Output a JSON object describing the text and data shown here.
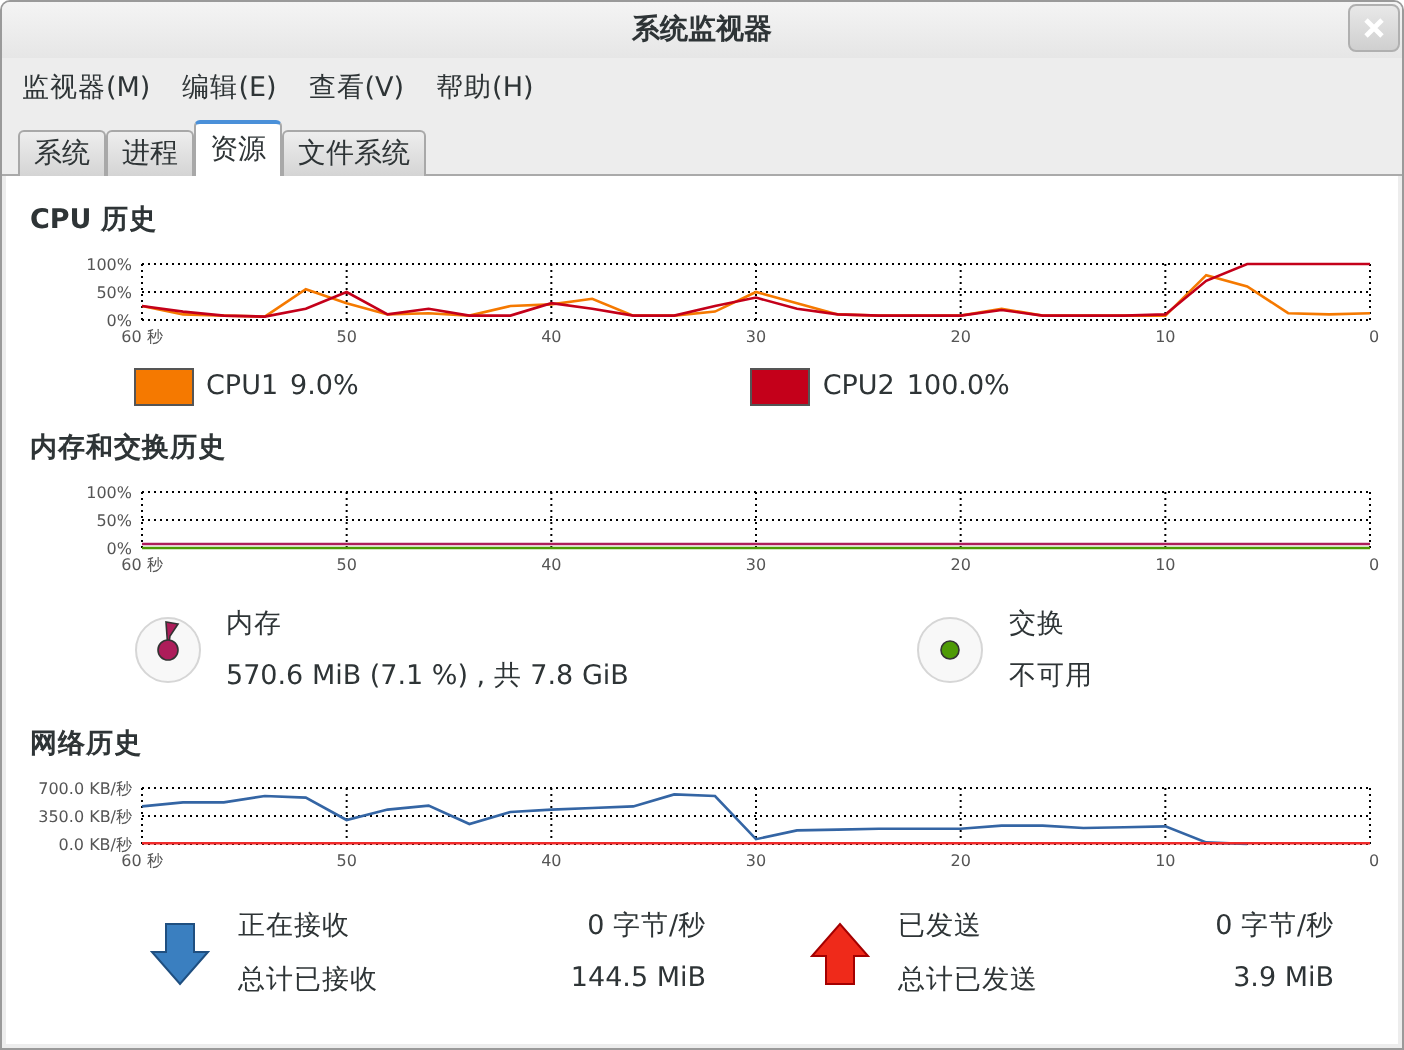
{
  "window": {
    "title": "系统监视器"
  },
  "menu": [
    {
      "label": "监视器(M)"
    },
    {
      "label": "编辑(E)"
    },
    {
      "label": "查看(V)"
    },
    {
      "label": "帮助(H)"
    }
  ],
  "tabs": [
    {
      "label": "系统",
      "selected": false
    },
    {
      "label": "进程",
      "selected": false
    },
    {
      "label": "资源",
      "selected": true
    },
    {
      "label": "文件系统",
      "selected": false
    }
  ],
  "cpu": {
    "title": "CPU 历史",
    "chart_data": {
      "type": "line",
      "grid": true,
      "x": [
        60,
        58,
        56,
        54,
        52,
        50,
        48,
        46,
        44,
        42,
        40,
        38,
        36,
        34,
        32,
        30,
        28,
        26,
        24,
        22,
        20,
        18,
        16,
        14,
        12,
        10,
        8,
        6,
        4,
        2,
        0
      ],
      "xlim": [
        60,
        0
      ],
      "ylim": [
        0,
        100
      ],
      "xticks": [
        {
          "value": 60,
          "label": "60 秒"
        },
        {
          "value": 50,
          "label": "50"
        },
        {
          "value": 40,
          "label": "40"
        },
        {
          "value": 30,
          "label": "30"
        },
        {
          "value": 20,
          "label": "20"
        },
        {
          "value": 10,
          "label": "10"
        },
        {
          "value": 0,
          "label": "0"
        }
      ],
      "yticks": [
        {
          "value": 0,
          "label": "0%"
        },
        {
          "value": 50,
          "label": "50%"
        },
        {
          "value": 100,
          "label": "100%"
        }
      ],
      "series": [
        {
          "name": "CPU1",
          "color": "#f57900",
          "values": [
            25,
            10,
            8,
            6,
            55,
            30,
            10,
            12,
            8,
            25,
            28,
            38,
            8,
            8,
            15,
            50,
            30,
            10,
            8,
            8,
            8,
            20,
            8,
            8,
            8,
            8,
            80,
            60,
            12,
            10,
            12
          ]
        },
        {
          "name": "CPU2",
          "color": "#c4001a",
          "values": [
            25,
            15,
            8,
            6,
            20,
            50,
            10,
            20,
            8,
            8,
            30,
            20,
            8,
            8,
            25,
            40,
            20,
            10,
            8,
            8,
            8,
            18,
            8,
            8,
            8,
            10,
            70,
            100,
            100,
            100,
            100
          ]
        }
      ]
    },
    "legend": [
      {
        "value": "9.0%"
      },
      {
        "value": "100.0%"
      }
    ]
  },
  "memory": {
    "title": "内存和交换历史",
    "chart_data": {
      "type": "line",
      "grid": true,
      "x": [
        60,
        0
      ],
      "xlim": [
        60,
        0
      ],
      "ylim": [
        0,
        100
      ],
      "xticks": [
        {
          "value": 60,
          "label": "60 秒"
        },
        {
          "value": 50,
          "label": "50"
        },
        {
          "value": 40,
          "label": "40"
        },
        {
          "value": 30,
          "label": "30"
        },
        {
          "value": 20,
          "label": "20"
        },
        {
          "value": 10,
          "label": "10"
        },
        {
          "value": 0,
          "label": "0"
        }
      ],
      "yticks": [
        {
          "value": 0,
          "label": "0%"
        },
        {
          "value": 50,
          "label": "50%"
        },
        {
          "value": 100,
          "label": "100%"
        }
      ],
      "series": [
        {
          "name": "内存",
          "color": "#ad1d5a",
          "values": [
            7,
            7
          ]
        },
        {
          "name": "交换",
          "color": "#4e9a06",
          "values": [
            0,
            0
          ]
        }
      ]
    },
    "items": [
      {
        "kind": "memory",
        "value": "570.6 MiB (7.1 %) , 共 7.8 GiB"
      },
      {
        "kind": "swap",
        "value": "不可用"
      }
    ]
  },
  "network": {
    "title": "网络历史",
    "chart_data": {
      "type": "line",
      "grid": true,
      "x": [
        60,
        58,
        56,
        54,
        52,
        50,
        48,
        46,
        44,
        42,
        40,
        38,
        36,
        34,
        32,
        30,
        28,
        26,
        24,
        22,
        20,
        18,
        16,
        14,
        12,
        10,
        8,
        6,
        4,
        2,
        0
      ],
      "xlim": [
        60,
        0
      ],
      "ylim": [
        0,
        700
      ],
      "xticks": [
        {
          "value": 60,
          "label": "60 秒"
        },
        {
          "value": 50,
          "label": "50"
        },
        {
          "value": 40,
          "label": "40"
        },
        {
          "value": 30,
          "label": "30"
        },
        {
          "value": 20,
          "label": "20"
        },
        {
          "value": 10,
          "label": "10"
        },
        {
          "value": 0,
          "label": "0"
        }
      ],
      "yticks": [
        {
          "value": 0,
          "label": "0.0 KB/秒"
        },
        {
          "value": 350,
          "label": "350.0 KB/秒"
        },
        {
          "value": 700,
          "label": "700.0 KB/秒"
        }
      ],
      "series": [
        {
          "color": "#3465a4",
          "values": [
            470,
            520,
            520,
            600,
            580,
            300,
            430,
            480,
            250,
            400,
            430,
            450,
            470,
            620,
            600,
            60,
            170,
            180,
            190,
            190,
            190,
            230,
            230,
            200,
            210,
            220,
            20,
            0,
            null,
            null,
            null
          ]
        },
        {
          "color": "#ef2929",
          "values": [
            10,
            10,
            10,
            10,
            10,
            10,
            10,
            10,
            10,
            10,
            10,
            10,
            10,
            10,
            10,
            10,
            10,
            10,
            10,
            10,
            10,
            10,
            10,
            10,
            10,
            10,
            10,
            10,
            10,
            10,
            10
          ]
        }
      ]
    },
    "stats": [
      {
        "kind": "received",
        "rows": [
          {
            "label": "正在接收",
            "value": "0 字节/秒"
          },
          {
            "label": "总计已接收",
            "value": "144.5 MiB"
          }
        ]
      },
      {
        "kind": "sent",
        "rows": [
          {
            "label": "已发送",
            "value": "0 字节/秒"
          },
          {
            "label": "总计已发送",
            "value": "3.9 MiB"
          }
        ]
      }
    ]
  }
}
